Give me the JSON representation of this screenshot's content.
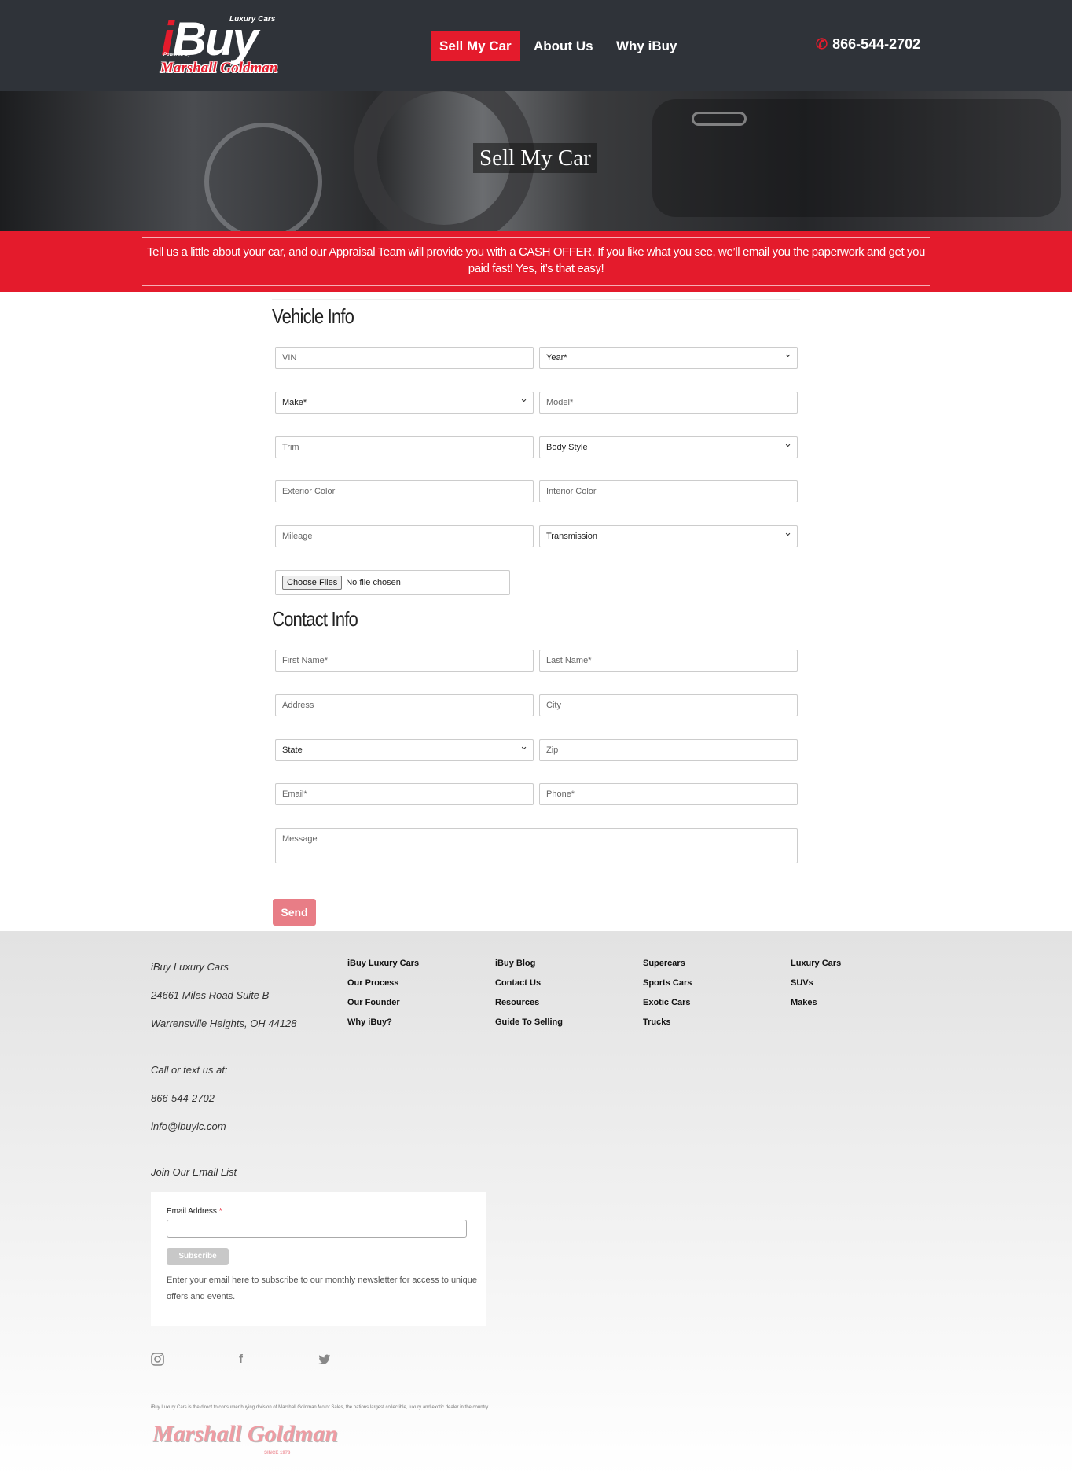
{
  "header": {
    "logo": {
      "main": "iBuy",
      "tag": "Luxury Cars",
      "powered": "Powered By",
      "brand": "Marshall Goldman"
    },
    "nav": [
      "Sell My Car",
      "About Us",
      "Why iBuy"
    ],
    "phone": "866-544-2702",
    "colors": {
      "bar": "#2f3339",
      "accent": "#e41b2c"
    }
  },
  "hero": {
    "title": "Sell My Car"
  },
  "banner": {
    "text": "Tell us a little about your car, and our Appraisal Team will provide you with a CASH OFFER. If you like what you see, we’ll email you the paperwork and get you paid fast! Yes, it’s that easy!"
  },
  "vehicle": {
    "heading": "Vehicle Info",
    "vin": "VIN",
    "year": "Year*",
    "make": "Make*",
    "model": "Model*",
    "trim": "Trim",
    "body_style": "Body Style",
    "exterior": "Exterior Color",
    "interior": "Interior Color",
    "mileage": "Mileage",
    "transmission": "Transmission",
    "file_button": "Choose Files",
    "file_status": "No file chosen"
  },
  "contact": {
    "heading": "Contact Info",
    "first": "First Name*",
    "last": "Last Name*",
    "address": "Address",
    "city": "City",
    "state": "State",
    "zip": "Zip",
    "email": "Email*",
    "phone": "Phone*",
    "message": "Message",
    "send": "Send"
  },
  "footer": {
    "company": "iBuy Luxury Cars",
    "street": "24661 Miles Road Suite B",
    "city": "Warrensville Heights, OH 44128",
    "call_label": "Call or text us at:",
    "phone": "866-544-2702",
    "email": "info@ibuylc.com",
    "join": "Join Our Email List",
    "links_col1": [
      "iBuy Luxury Cars",
      "Our Process",
      "Our Founder",
      "Why iBuy?"
    ],
    "links_col2": [
      "iBuy Blog",
      "Contact Us",
      "Resources",
      "Guide To Selling"
    ],
    "links_col3": [
      "Supercars",
      "Sports Cars",
      "Exotic Cars",
      "Trucks"
    ],
    "links_col4": [
      "Luxury Cars",
      "SUVs",
      "Makes"
    ],
    "newsletter": {
      "label": "Email Address",
      "required": "*",
      "button": "Subscribe",
      "desc": "Enter your email here to subscribe to our monthly newsletter for access to unique offers and events."
    },
    "social": [
      "instagram-icon",
      "facebook-icon",
      "twitter-icon"
    ],
    "legal": "iBuy Luxury Cars is the direct to consumer buying division of Marshall Goldman Motor Sales, the nations largest collectible, luxury and exotic dealer in the country.",
    "logo": "Marshall Goldman",
    "since": "SINCE 1978"
  }
}
